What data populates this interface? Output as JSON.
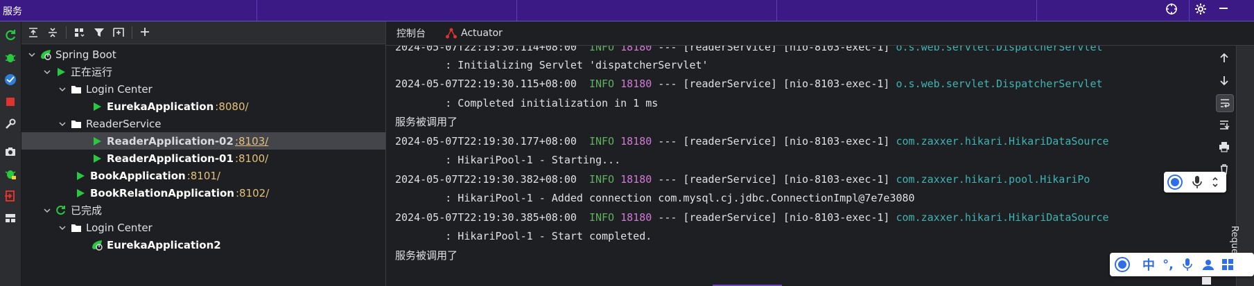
{
  "titlebar": {
    "title": "服务",
    "icons": [
      "target-icon",
      "gear-icon",
      "minimize-icon"
    ]
  },
  "left_rail": {
    "icons": [
      "rerun-icon",
      "debug-icon",
      "coverage-icon",
      "stop-icon",
      "settings-wrench-icon",
      "snapshot-icon",
      "debug-bug-icon",
      "exit-icon",
      "layout-icon"
    ]
  },
  "tree_toolbar": {
    "icons": [
      "expand-all-icon",
      "collapse-all-icon",
      "group-by-icon",
      "filter-icon",
      "new-config-icon",
      "add-icon"
    ]
  },
  "tree": {
    "root": "Spring Boot",
    "running": "正在运行",
    "login_center_1": "Login Center",
    "eureka_app": "EurekaApplication",
    "eureka_port": ":8080/",
    "reader_service": "ReaderService",
    "reader_02": "ReaderApplication-02",
    "reader_02_port": ":8103/",
    "reader_01": "ReaderApplication-01",
    "reader_01_port": ":8100/",
    "book_app": "BookApplication",
    "book_port": ":8101/",
    "book_relation": "BookRelationApplication",
    "book_relation_port": ":8102/",
    "finished": "已完成",
    "login_center_2": "Login Center",
    "eureka_app2": "EurekaApplication2"
  },
  "console_tabs": {
    "console": "控制台",
    "actuator": "Actuator"
  },
  "console": {
    "l0_ts": "2024-05-07T22:19:30.114+08:00",
    "l0_lvl": "INFO",
    "l0_pid": "18180",
    "l0_mid": " --- [readerService] [nio-8103-exec-1] ",
    "l0_logger": "o.s.web.servlet.DispatcherServlet",
    "l1_msg": "        : Initializing Servlet 'dispatcherServlet'",
    "l2_ts": "2024-05-07T22:19:30.115+08:00",
    "l2_lvl": "INFO",
    "l2_pid": "18180",
    "l2_mid": " --- [readerService] [nio-8103-exec-1] ",
    "l2_logger": "o.s.web.servlet.DispatcherServlet",
    "l3_msg": "        : Completed initialization in 1 ms",
    "l4_msg": "服务被调用了",
    "l5_ts": "2024-05-07T22:19:30.177+08:00",
    "l5_lvl": "INFO",
    "l5_pid": "18180",
    "l5_mid": " --- [readerService] [nio-8103-exec-1] ",
    "l5_logger": "com.zaxxer.hikari.HikariDataSource",
    "l6_msg": "        : HikariPool-1 - Starting...",
    "l7_ts": "2024-05-07T22:19:30.382+08:00",
    "l7_lvl": "INFO",
    "l7_pid": "18180",
    "l7_mid": " --- [readerService] [nio-8103-exec-1] ",
    "l7_logger": "com.zaxxer.hikari.pool.HikariPo",
    "l8_msg": "        : HikariPool-1 - Added connection com.mysql.cj.jdbc.ConnectionImpl@7e7e3080",
    "l9_ts": "2024-05-07T22:19:30.385+08:00",
    "l9_lvl": "INFO",
    "l9_pid": "18180",
    "l9_mid": " --- [readerService] [nio-8103-exec-1] ",
    "l9_logger": "com.zaxxer.hikari.HikariDataSource",
    "l10_msg": "        : HikariPool-1 - Start completed.",
    "l11_msg": "服务被调用了"
  },
  "right_strip": {
    "label": "Reque"
  },
  "ime": {
    "mode": "中",
    "punct": "°,"
  },
  "colors": {
    "titlebar": "#3b1a86",
    "info": "#5fb05f",
    "pid": "#d37ad8",
    "logger": "#3fb4b4",
    "port": "#e5c07b",
    "run": "#28c940"
  }
}
